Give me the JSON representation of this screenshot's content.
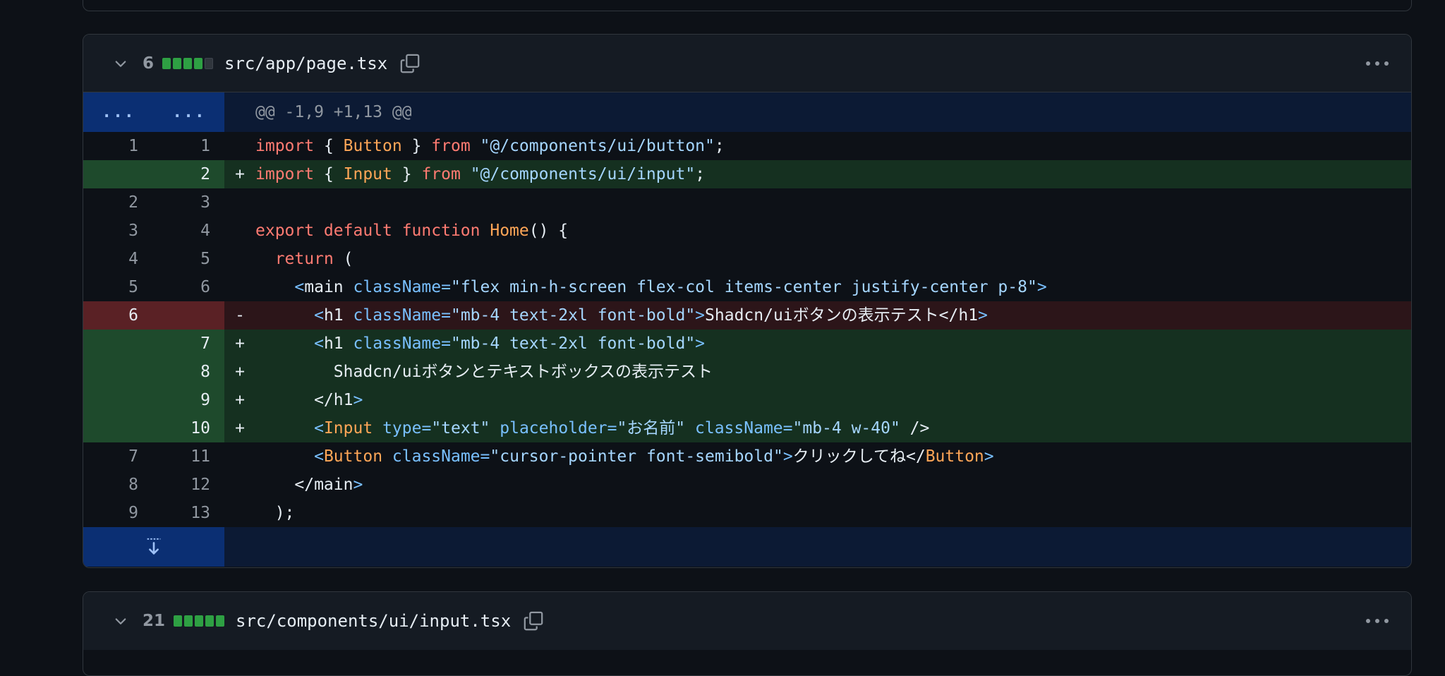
{
  "file1": {
    "count": "6",
    "filename": "src/app/page.tsx",
    "diffstat": [
      "add",
      "add",
      "add",
      "add",
      "neutral"
    ],
    "hunk_header": "@@ -1,9 +1,13 @@",
    "hunk_old": "...",
    "hunk_new": "...",
    "rows": [
      {
        "type": "ctx",
        "old": "1",
        "new": "1",
        "sign": " ",
        "code": [
          [
            "kw",
            "import"
          ],
          [
            "pun",
            " { "
          ],
          [
            "cls",
            "Button"
          ],
          [
            "pun",
            " } "
          ],
          [
            "kw",
            "from"
          ],
          [
            "pun",
            " "
          ],
          [
            "str",
            "\"@/components/ui/button\""
          ],
          [
            "pun",
            ";"
          ]
        ]
      },
      {
        "type": "add",
        "old": "",
        "new": "2",
        "sign": "+",
        "code": [
          [
            "kw",
            "import"
          ],
          [
            "pun",
            " { "
          ],
          [
            "cls",
            "Input"
          ],
          [
            "pun",
            " } "
          ],
          [
            "kw",
            "from"
          ],
          [
            "pun",
            " "
          ],
          [
            "str",
            "\"@/components/ui/input\""
          ],
          [
            "pun",
            ";"
          ]
        ]
      },
      {
        "type": "ctx",
        "old": "2",
        "new": "3",
        "sign": " ",
        "code": []
      },
      {
        "type": "ctx",
        "old": "3",
        "new": "4",
        "sign": " ",
        "code": [
          [
            "kw",
            "export default function"
          ],
          [
            "pun",
            " "
          ],
          [
            "cls",
            "Home"
          ],
          [
            "pun",
            "() {"
          ]
        ]
      },
      {
        "type": "ctx",
        "old": "4",
        "new": "5",
        "sign": " ",
        "code": [
          [
            "pun",
            "  "
          ],
          [
            "kw",
            "return"
          ],
          [
            "pun",
            " ("
          ]
        ]
      },
      {
        "type": "ctx",
        "old": "5",
        "new": "6",
        "sign": " ",
        "code": [
          [
            "pun",
            "    "
          ],
          [
            "brk",
            "<"
          ],
          [
            "pun",
            "main "
          ],
          [
            "attr",
            "className"
          ],
          [
            "brk",
            "="
          ],
          [
            "str",
            "\"flex min-h-screen flex-col items-center justify-center p-8\""
          ],
          [
            "brk",
            ">"
          ]
        ]
      },
      {
        "type": "del",
        "old": "6",
        "new": "",
        "sign": "-",
        "code": [
          [
            "pun",
            "      "
          ],
          [
            "brk",
            "<"
          ],
          [
            "pun",
            "h1 "
          ],
          [
            "attr",
            "className"
          ],
          [
            "brk",
            "="
          ],
          [
            "str",
            "\"mb-4 text-2xl font-bold\""
          ],
          [
            "brk",
            ">"
          ],
          [
            "pun",
            "Shadcn/uiボタンの表示テスト</h1"
          ],
          [
            "brk",
            ">"
          ]
        ]
      },
      {
        "type": "add",
        "old": "",
        "new": "7",
        "sign": "+",
        "code": [
          [
            "pun",
            "      "
          ],
          [
            "brk",
            "<"
          ],
          [
            "pun",
            "h1 "
          ],
          [
            "attr",
            "className"
          ],
          [
            "brk",
            "="
          ],
          [
            "str",
            "\"mb-4 text-2xl font-bold\""
          ],
          [
            "brk",
            ">"
          ]
        ]
      },
      {
        "type": "add",
        "old": "",
        "new": "8",
        "sign": "+",
        "code": [
          [
            "pun",
            "        Shadcn/uiボタンとテキストボックスの表示テスト"
          ]
        ]
      },
      {
        "type": "add",
        "old": "",
        "new": "9",
        "sign": "+",
        "code": [
          [
            "pun",
            "      </h1"
          ],
          [
            "brk",
            ">"
          ]
        ]
      },
      {
        "type": "add",
        "old": "",
        "new": "10",
        "sign": "+",
        "code": [
          [
            "pun",
            "      "
          ],
          [
            "brk",
            "<"
          ],
          [
            "cls",
            "Input"
          ],
          [
            "pun",
            " "
          ],
          [
            "attr",
            "type"
          ],
          [
            "brk",
            "="
          ],
          [
            "str",
            "\"text\""
          ],
          [
            "pun",
            " "
          ],
          [
            "attr",
            "placeholder"
          ],
          [
            "brk",
            "="
          ],
          [
            "str",
            "\"お名前\""
          ],
          [
            "pun",
            " "
          ],
          [
            "attr",
            "className"
          ],
          [
            "brk",
            "="
          ],
          [
            "str",
            "\"mb-4 w-40\""
          ],
          [
            "pun",
            " />"
          ]
        ]
      },
      {
        "type": "ctx",
        "old": "7",
        "new": "11",
        "sign": " ",
        "code": [
          [
            "pun",
            "      "
          ],
          [
            "brk",
            "<"
          ],
          [
            "cls",
            "Button"
          ],
          [
            "pun",
            " "
          ],
          [
            "attr",
            "className"
          ],
          [
            "brk",
            "="
          ],
          [
            "str",
            "\"cursor-pointer font-semibold\""
          ],
          [
            "brk",
            ">"
          ],
          [
            "pun",
            "クリックしてね</"
          ],
          [
            "cls",
            "Button"
          ],
          [
            "brk",
            ">"
          ]
        ]
      },
      {
        "type": "ctx",
        "old": "8",
        "new": "12",
        "sign": " ",
        "code": [
          [
            "pun",
            "    </main"
          ],
          [
            "brk",
            ">"
          ]
        ]
      },
      {
        "type": "ctx",
        "old": "9",
        "new": "13",
        "sign": " ",
        "code": [
          [
            "pun",
            "  );"
          ]
        ]
      }
    ]
  },
  "file2": {
    "count": "21",
    "filename": "src/components/ui/input.tsx",
    "diffstat": [
      "add",
      "add",
      "add",
      "add",
      "add"
    ]
  },
  "colors": {
    "add_bg": "#153020",
    "del_bg": "#2c1519",
    "hunk_bg": "#0c1a34",
    "accent_blue": "#0b2f73"
  }
}
